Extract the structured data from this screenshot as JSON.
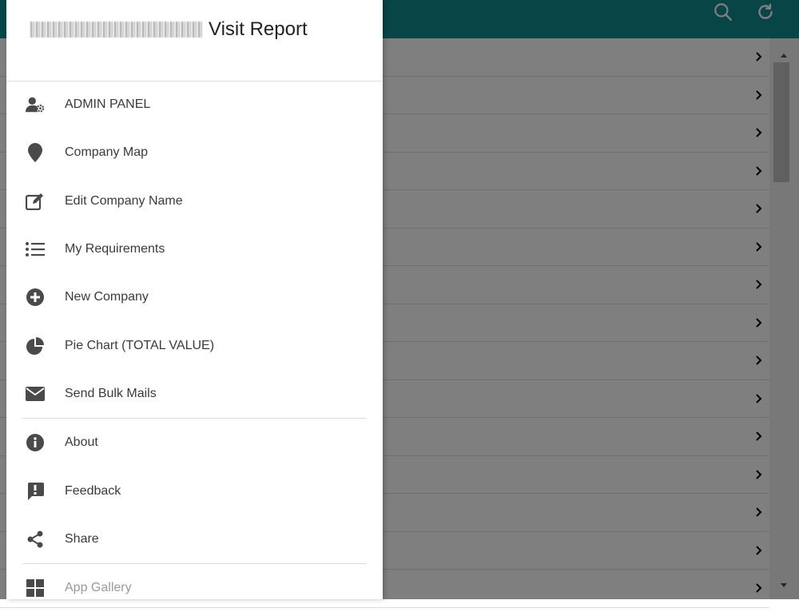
{
  "app": {
    "drawer_title": "Visit Report",
    "accent_color": "#0f8a8f"
  },
  "menu_group_1": [
    {
      "label": "ADMIN PANEL",
      "icon": "user-gear-icon"
    },
    {
      "label": "Company Map",
      "icon": "map-pin-icon"
    },
    {
      "label": "Edit Company Name",
      "icon": "edit-icon"
    },
    {
      "label": "My Requirements",
      "icon": "list-icon"
    },
    {
      "label": "New Company",
      "icon": "plus-circle-icon"
    },
    {
      "label": "Pie Chart (TOTAL VALUE)",
      "icon": "pie-chart-icon"
    },
    {
      "label": "Send Bulk Mails",
      "icon": "envelope-icon"
    }
  ],
  "menu_group_2": [
    {
      "label": "About",
      "icon": "info-icon"
    },
    {
      "label": "Feedback",
      "icon": "feedback-icon"
    },
    {
      "label": "Share",
      "icon": "share-icon"
    }
  ],
  "menu_group_3": [
    {
      "label": "App Gallery",
      "icon": "grid-icon"
    }
  ]
}
